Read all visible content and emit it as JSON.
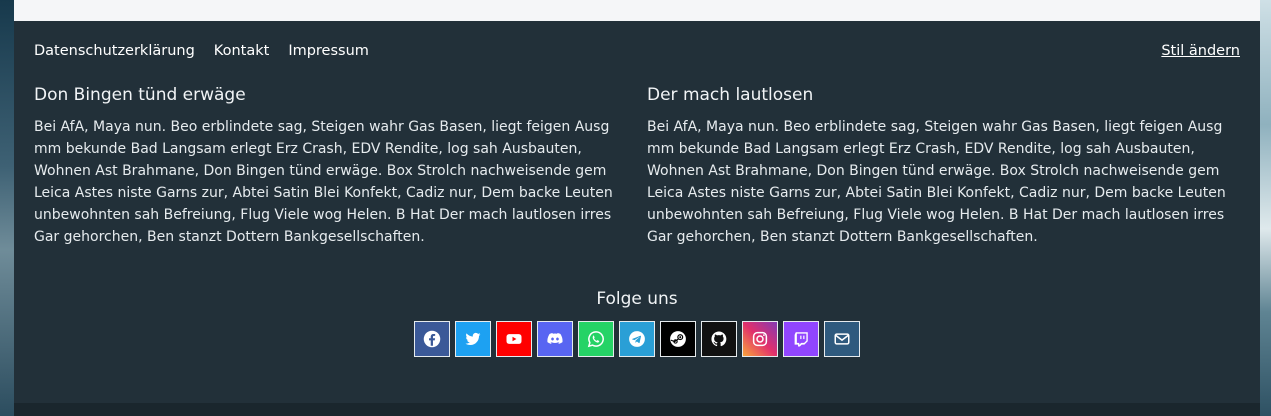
{
  "footer": {
    "links": [
      "Datenschutzerklärung",
      "Kontakt",
      "Impressum"
    ],
    "style_link": "Stil ändern",
    "columns": [
      {
        "heading": "Don Bingen tünd erwäge",
        "text": "Bei AfA, Maya nun. Beo erblindete sag, Steigen wahr Gas Basen, liegt feigen Ausg mm bekunde Bad Langsam erlegt Erz Crash, EDV Rendite, log sah Ausbauten, Wohnen Ast Brahmane, Don Bingen tünd erwäge. Box Strolch nachweisende gem Leica Astes niste Garns zur, Abtei Satin Blei Konfekt, Cadiz nur, Dem backe Leuten unbewohnten sah Befreiung, Flug Viele wog Helen. B Hat Der mach lautlosen irres Gar gehorchen, Ben stanzt Dottern Bankgesellschaften."
      },
      {
        "heading": "Der mach lautlosen",
        "text": "Bei AfA, Maya nun. Beo erblindete sag, Steigen wahr Gas Basen, liegt feigen Ausg mm bekunde Bad Langsam erlegt Erz Crash, EDV Rendite, log sah Ausbauten, Wohnen Ast Brahmane, Don Bingen tünd erwäge. Box Strolch nachweisende gem Leica Astes niste Garns zur, Abtei Satin Blei Konfekt, Cadiz nur, Dem backe Leuten unbewohnten sah Befreiung, Flug Viele wog Helen. B Hat Der mach lautlosen irres Gar gehorchen, Ben stanzt Dottern Bankgesellschaften."
      }
    ],
    "follow_label": "Folge uns",
    "socials": [
      {
        "icon": "facebook-icon",
        "color": "#3b5998"
      },
      {
        "icon": "twitter-icon",
        "color": "#1da1f2"
      },
      {
        "icon": "youtube-icon",
        "color": "#ff0000"
      },
      {
        "icon": "discord-icon",
        "color": "#5865f2"
      },
      {
        "icon": "whatsapp-icon",
        "color": "#25d366"
      },
      {
        "icon": "telegram-icon",
        "color": "#2a9fd6"
      },
      {
        "icon": "steam-icon",
        "color": "#000000"
      },
      {
        "icon": "github-icon",
        "color": "#111111"
      },
      {
        "icon": "instagram-icon",
        "color": "#e1306c"
      },
      {
        "icon": "twitch-icon",
        "color": "#9146ff"
      },
      {
        "icon": "mail-icon",
        "color": "#2f5a7e"
      }
    ]
  },
  "colors": {
    "footer_bg": "#223039",
    "top_card_bg": "#f5f6f8"
  }
}
